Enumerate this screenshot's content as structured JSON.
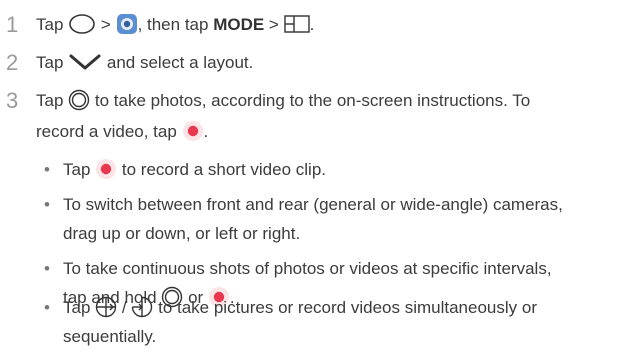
{
  "steps": [
    {
      "number": "1",
      "t1": "Tap",
      "t2": ">",
      "t3": ", then tap",
      "mode": "MODE",
      "t4": ">",
      "t5": "."
    },
    {
      "number": "2",
      "t1": "Tap",
      "t2": "and select a layout."
    },
    {
      "number": "3",
      "t1": "Tap",
      "t2": "to take photos, according to the on-screen instructions. To",
      "t3": "record a video, tap",
      "t4": "."
    }
  ],
  "bullets": [
    {
      "dot": "•",
      "t1": "Tap",
      "t2": "to record a short video clip."
    },
    {
      "dot": "•",
      "line1": "To switch between front and rear (general or wide-angle) cameras,",
      "line2": "drag up or down, or left or right."
    },
    {
      "dot": "•",
      "line1": "To take continuous shots of photos or videos at specific intervals,",
      "t1": "tap and hold",
      "t2": "or",
      "t3": "."
    },
    {
      "dot": "•",
      "t1": "Tap",
      "t2": "/",
      "t3": "to take pictures or record videos simultaneously or",
      "line2": "sequentially."
    }
  ],
  "icons": {
    "circle": "circle-outline-icon",
    "camera_app": "camera-app-icon",
    "split_layout": "split-layout-icon",
    "chevron": "chevron-down-icon",
    "shutter": "shutter-icon",
    "record": "record-icon",
    "simultaneous": "simultaneous-mode-icon",
    "sequential": "sequential-mode-icon"
  },
  "colors": {
    "record_red": "#e8384f",
    "text": "#3c3c3c",
    "step_number": "#9a9a9a",
    "camera_blue": "#5b8fd1"
  }
}
